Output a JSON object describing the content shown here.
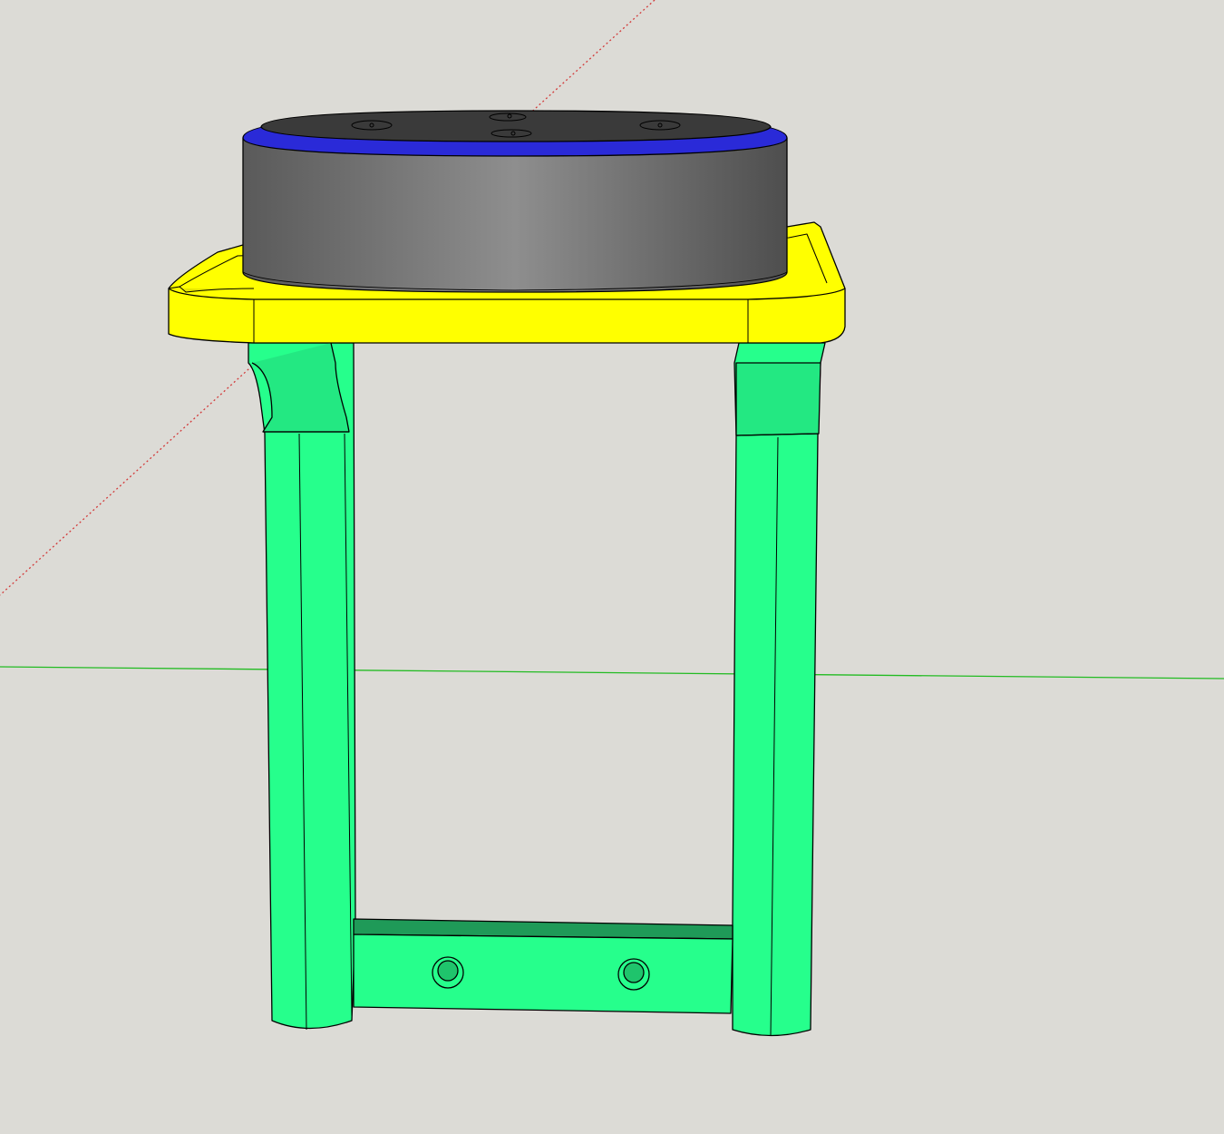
{
  "viewport": {
    "type": "3d-model-viewport",
    "background_color": "#dcdbd6",
    "axes": {
      "red_axis_color": "#d23a3a",
      "red_axis_style": "dotted",
      "green_axis_color": "#22bb22",
      "green_axis_style": "solid"
    },
    "model": {
      "parts": [
        {
          "name": "cylinder-puck",
          "body_color": "#8a8a8a",
          "top_color": "#3a3a3a",
          "rim_color": "#2a2ad8"
        },
        {
          "name": "top-plate",
          "color": "#ffff00"
        },
        {
          "name": "frame-legs",
          "color": "#26ff8c"
        },
        {
          "name": "crossbar",
          "color": "#26ff8c",
          "hole_count": 2
        }
      ]
    }
  }
}
